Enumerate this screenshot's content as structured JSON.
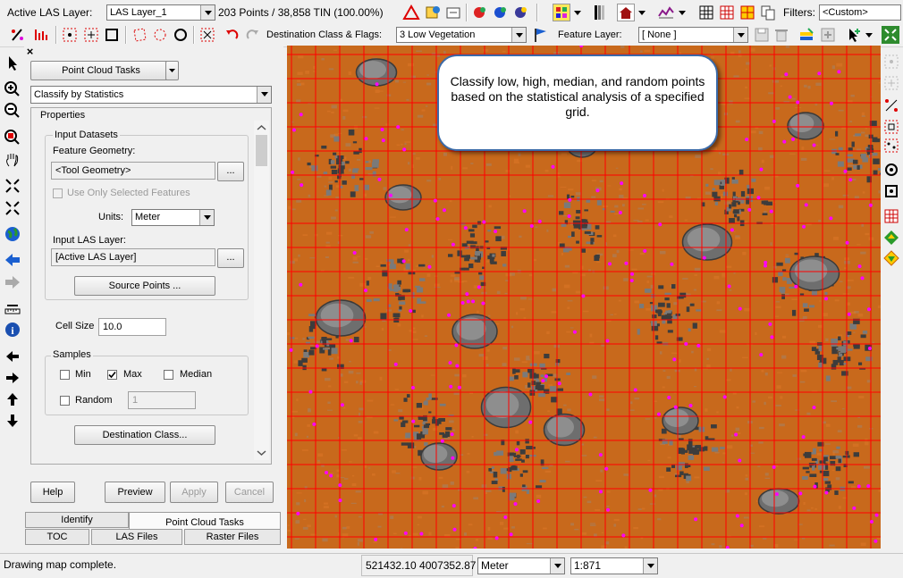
{
  "toolbar": {
    "active_las_label": "Active LAS Layer:",
    "active_las_value": "LAS Layer_1",
    "points_info": "203 Points / 38,858 TIN (100.00%)",
    "filters_label": "Filters:",
    "filters_value": "<Custom>",
    "dest_class_label": "Destination Class & Flags:",
    "dest_class_value": "3  Low Vegetation",
    "feature_layer_label": "Feature Layer:",
    "feature_layer_value": "[ None ]"
  },
  "panel": {
    "close_glyph": "×",
    "tasks_button": "Point Cloud Tasks",
    "tool_select": "Classify by Statistics",
    "properties_label": "Properties",
    "input_datasets_label": "Input Datasets",
    "feature_geometry_label": "Feature Geometry:",
    "feature_geometry_value": "<Tool Geometry>",
    "browse_label": "...",
    "use_selected_label": "Use Only Selected Features",
    "units_label": "Units:",
    "units_value": "Meter",
    "input_las_label": "Input LAS Layer:",
    "input_las_value": "[Active LAS Layer]",
    "source_points_button": "Source Points ...",
    "cell_size_label": "Cell Size",
    "cell_size_value": "10.0",
    "samples_label": "Samples",
    "min_label": "Min",
    "max_label": "Max",
    "median_label": "Median",
    "random_label": "Random",
    "random_value": "1",
    "destination_class_button": "Destination Class...",
    "checks": {
      "use_selected": false,
      "min": false,
      "max": true,
      "median": false,
      "random": false
    },
    "buttons": {
      "help": "Help",
      "preview": "Preview",
      "apply": "Apply",
      "cancel": "Cancel"
    },
    "tabs_row1": [
      "Identify",
      "Point Cloud Tasks"
    ],
    "tabs_row2": [
      "TOC",
      "LAS Files",
      "Raster Files"
    ]
  },
  "map": {
    "callout_text": "Classify low, high, median, and random points based on the statistical analysis of a specified grid.",
    "colors": {
      "terrain": "#c8691c",
      "grid": "#ff0000",
      "points": "#ff00ff",
      "objects": "#6e6e6e"
    }
  },
  "statusbar": {
    "message": "Drawing map complete.",
    "coords": "521432.10 4007352.87",
    "units": "Meter",
    "scale": "1:871"
  }
}
